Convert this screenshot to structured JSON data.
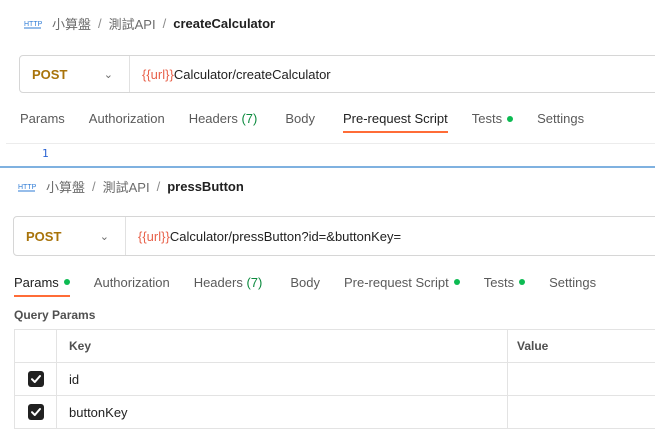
{
  "panel1": {
    "breadcrumb": {
      "collection": "小算盤",
      "folder": "測試API",
      "request": "createCalculator"
    },
    "method": "POST",
    "url_var": "{{url}}",
    "url_rest": "Calculator/createCalculator",
    "tabs": [
      {
        "label": "Params"
      },
      {
        "label": "Authorization"
      },
      {
        "label": "Headers",
        "count": "(7)"
      },
      {
        "label": "Body"
      },
      {
        "label": "Pre-request Script",
        "active": true
      },
      {
        "label": "Tests",
        "dot": true
      },
      {
        "label": "Settings"
      }
    ],
    "editor_line": "1"
  },
  "panel2": {
    "breadcrumb": {
      "collection": "小算盤",
      "folder": "測試API",
      "request": "pressButton"
    },
    "method": "POST",
    "url_var": "{{url}}",
    "url_rest": "Calculator/pressButton?id=&buttonKey=",
    "tabs": [
      {
        "label": "Params",
        "active": true,
        "dot": true
      },
      {
        "label": "Authorization"
      },
      {
        "label": "Headers",
        "count": "(7)"
      },
      {
        "label": "Body"
      },
      {
        "label": "Pre-request Script",
        "dot": true
      },
      {
        "label": "Tests",
        "dot": true
      },
      {
        "label": "Settings"
      }
    ],
    "query_params_title": "Query Params",
    "table": {
      "headers": {
        "key": "Key",
        "value": "Value"
      },
      "rows": [
        {
          "key": "id",
          "value": "",
          "checked": true
        },
        {
          "key": "buttonKey",
          "value": "",
          "checked": true
        }
      ]
    }
  },
  "colors": {
    "method": "#a8730a",
    "variable": "#e8624b",
    "active_tab": "#ff6c37",
    "dot": "#0cbb52"
  },
  "icons": {
    "request_type": "http-icon",
    "dropdown": "chevron-down-icon",
    "checkbox": "check-icon"
  }
}
